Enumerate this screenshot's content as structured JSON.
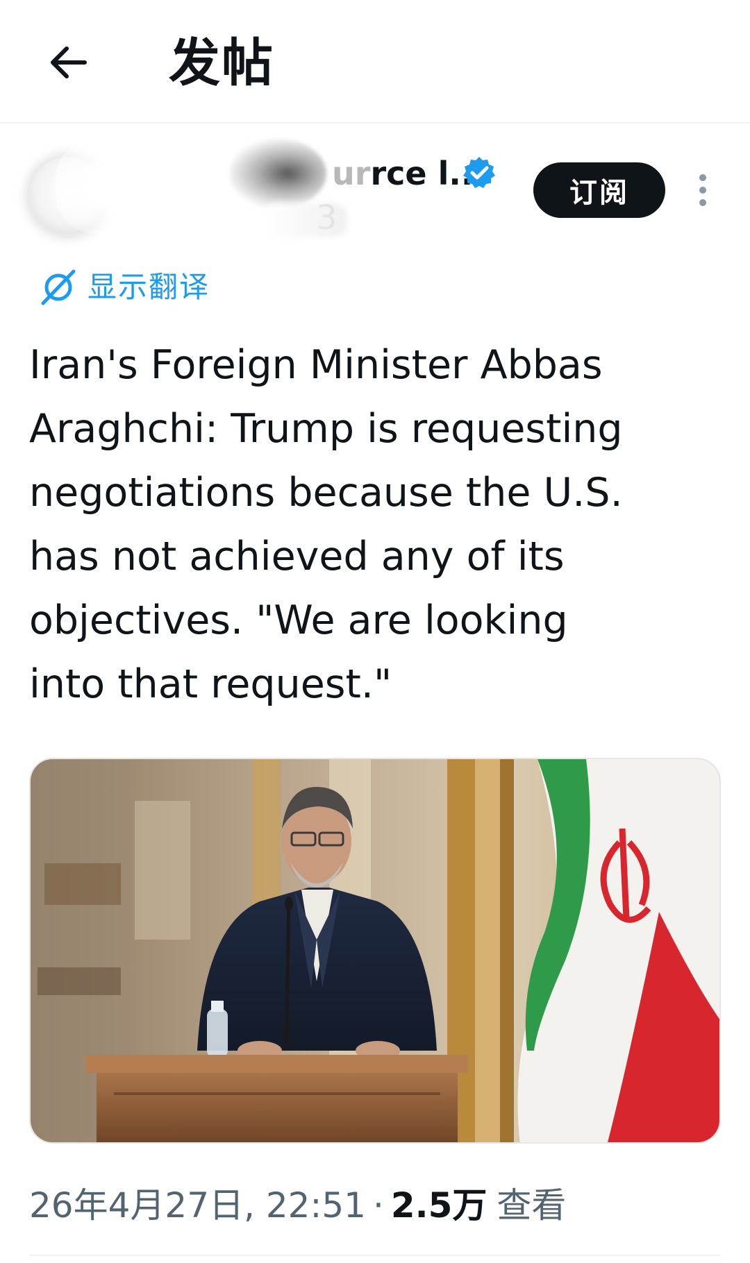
{
  "header": {
    "back_icon": "arrow-left-icon",
    "title": "发帖"
  },
  "author": {
    "display_name_visible": "rce l...",
    "display_name_faded_prefix": "ur",
    "handle_fragment": "3",
    "verified_icon": "verified-badge-icon",
    "verified_color": "#1d9bf0",
    "subscribe_label": "订阅",
    "more_icon": "more-vertical-icon"
  },
  "translate": {
    "icon": "translate-icon",
    "label": "显示翻译",
    "color": "#1d9bf0"
  },
  "tweet": {
    "lines": [
      "Iran's Foreign Minister Abbas",
      "Araghchi: Trump is requesting",
      "negotiations because the U.S.",
      "has not achieved any of its",
      "objectives. \"We are looking",
      "into that request.\""
    ]
  },
  "media": {
    "description_icon": "photo-speaker-at-podium-with-flag"
  },
  "meta": {
    "timestamp": "26年4月27日, 22:51",
    "separator": "·",
    "views_count": "2.5万",
    "views_label": "查看"
  }
}
